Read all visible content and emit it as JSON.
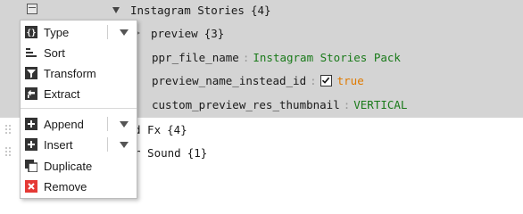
{
  "tree": {
    "root": {
      "key": "Instagram Stories",
      "count": "{4}"
    },
    "preview": {
      "key": "preview",
      "count": "{3}"
    },
    "ppr_file_name": {
      "key": "ppr_file_name",
      "value": "Instagram Stories Pack"
    },
    "preview_name_instead_id": {
      "key": "preview_name_instead_id",
      "value": "true",
      "checked": true
    },
    "custom_preview_res_thumbnail": {
      "key": "custom_preview_res_thumbnail",
      "value": "VERTICAL"
    },
    "separator": ":",
    "row_fx": {
      "visible_text": "d Fx",
      "count": "{4}"
    },
    "row_sound": {
      "visible_text": "r Sound",
      "count": "{1}"
    }
  },
  "context_menu": {
    "items": {
      "type": "Type",
      "sort": "Sort",
      "transform": "Transform",
      "extract": "Extract",
      "append": "Append",
      "insert": "Insert",
      "duplicate": "Duplicate",
      "remove": "Remove"
    }
  },
  "colors": {
    "selected_band": "#d4d4d4",
    "value_string": "#1a7a1a",
    "value_boolean": "#e07a00",
    "remove_icon": "#e53935",
    "icon_dark": "#333333"
  }
}
